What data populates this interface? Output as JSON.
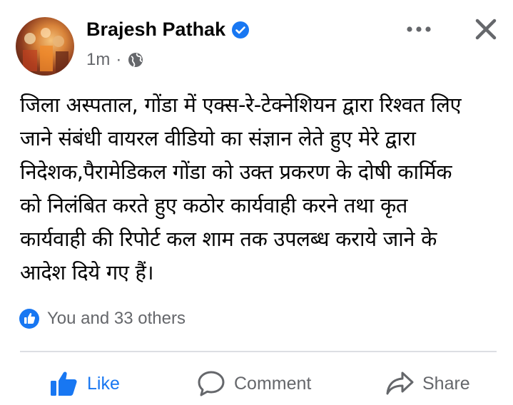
{
  "post": {
    "author": "Brajesh Pathak",
    "time": "1m",
    "separator": "·",
    "lines": [
      "जिला अस्पताल, गोंडा में एक्स-रे-टेक्नेशियन द्वारा रिश्वत लिए",
      "जाने संबंधी वायरल वीडियो का संज्ञान लेते हुए मेरे द्वारा",
      "निदेशक,पैरामेडिकल गोंडा को उक्त प्रकरण के दोषी कार्मिक",
      "को निलंबित करते हुए कठोर कार्यवाही करने तथा कृत",
      "कार्यवाही की रिपोर्ट कल शाम तक उपलब्ध कराये जाने के",
      "आदेश दिये गए हैं।"
    ],
    "reactions_text": "You and 33 others"
  },
  "actions": {
    "like_label": "Like",
    "comment_label": "Comment",
    "share_label": "Share"
  },
  "icons": {
    "verified": "verified-badge-icon",
    "privacy": "globe-icon",
    "more": "more-options-icon",
    "close": "close-icon",
    "like_reaction": "like-reaction-icon",
    "like": "thumbs-up-icon",
    "comment": "comment-icon",
    "share": "share-icon"
  },
  "colors": {
    "brand_blue": "#1877f2",
    "secondary_text": "#65676b",
    "primary_text": "#050505",
    "divider": "#dcdee3"
  }
}
